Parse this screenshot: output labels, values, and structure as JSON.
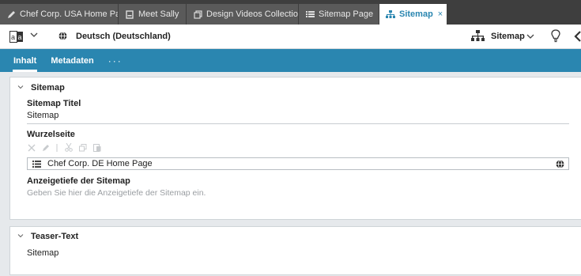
{
  "tabs": [
    {
      "label": "Chef Corp. USA Home Pa...",
      "icon": "pencil-icon",
      "active": false
    },
    {
      "label": "Meet Sally",
      "icon": "page-icon",
      "active": false
    },
    {
      "label": "Design Videos Collection",
      "icon": "collection-icon",
      "active": false
    },
    {
      "label": "Sitemap Page",
      "icon": "list-icon",
      "active": false
    },
    {
      "label": "Sitemap",
      "icon": "sitemap-icon",
      "active": true,
      "close": "×"
    }
  ],
  "toolbar": {
    "language_label": "Deutsch (Deutschland)",
    "view_label": "Sitemap"
  },
  "subtabs": {
    "content": "Inhalt",
    "metadata": "Metadaten",
    "more": "···"
  },
  "sitemap_panel": {
    "title": "Sitemap",
    "title_field_label": "Sitemap Titel",
    "title_field_value": "Sitemap",
    "root_label": "Wurzelseite",
    "root_value": "Chef Corp. DE Home Page",
    "depth_label": "Anzeigetiefe der Sitemap",
    "depth_placeholder": "Geben Sie hier die Anzeigetiefe der Sitemap ein."
  },
  "teaser_panel": {
    "title": "Teaser-Text",
    "value": "Sitemap"
  },
  "colors": {
    "accent": "#2a86b0",
    "tabbar_bg": "#3e3e3e",
    "tab_bg": "#5a5a5a"
  }
}
